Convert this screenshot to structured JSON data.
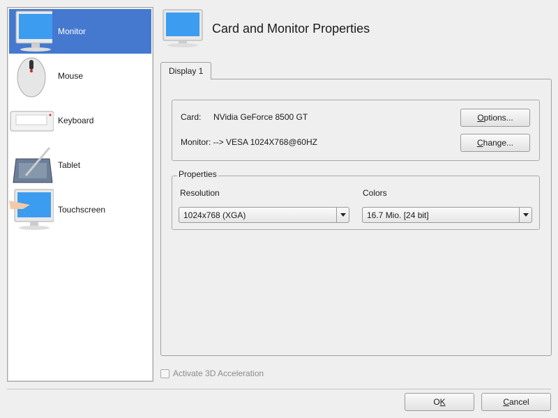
{
  "sidebar": {
    "items": [
      {
        "label": "Monitor",
        "icon": "monitor-icon",
        "selected": true
      },
      {
        "label": "Mouse",
        "icon": "mouse-icon"
      },
      {
        "label": "Keyboard",
        "icon": "keyboard-icon"
      },
      {
        "label": "Tablet",
        "icon": "tablet-icon"
      },
      {
        "label": "Touchscreen",
        "icon": "touchscreen-icon"
      }
    ]
  },
  "header": {
    "title": "Card and Monitor Properties",
    "icon": "monitor-icon"
  },
  "tabs": [
    {
      "label": "Display 1"
    }
  ],
  "card": {
    "label": "Card:",
    "value": "NVidia GeForce 8500 GT",
    "options_button": {
      "pre": "",
      "ul": "O",
      "post": "ptions..."
    }
  },
  "monitor": {
    "text": "Monitor: --> VESA 1024X768@60HZ",
    "change_button": {
      "ul": "C",
      "post": "hange..."
    }
  },
  "properties": {
    "legend": "Properties",
    "resolution_label": "Resolution",
    "resolution_value": "1024x768 (XGA)",
    "colors_label": "Colors",
    "colors_value": "16.7 Mio. [24 bit]"
  },
  "acceleration": {
    "label": "Activate 3D Acceleration",
    "checked": false,
    "enabled": false
  },
  "footer": {
    "ok": {
      "pre": "O",
      "ul": "K"
    },
    "cancel": {
      "ul": "C",
      "post": "ancel"
    }
  },
  "colors": {
    "selection": "#4479cf"
  }
}
